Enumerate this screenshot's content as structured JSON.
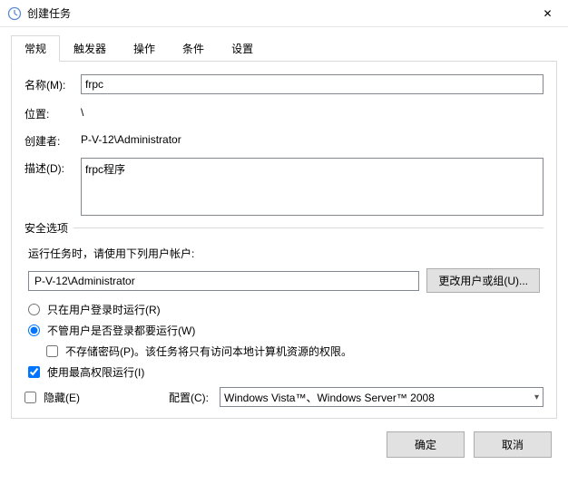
{
  "window": {
    "title": "创建任务",
    "close_glyph": "✕"
  },
  "tabs": {
    "general": "常规",
    "triggers": "触发器",
    "actions": "操作",
    "conditions": "条件",
    "settings": "设置"
  },
  "labels": {
    "name": "名称(M):",
    "location": "位置:",
    "author": "创建者:",
    "description": "描述(D):",
    "security": "安全选项",
    "run_as_prompt": "运行任务时，请使用下列用户帐户:",
    "change_user_btn": "更改用户或组(U)...",
    "radio_logged_on": "只在用户登录时运行(R)",
    "radio_whether": "不管用户是否登录都要运行(W)",
    "check_nopw": "不存储密码(P)。该任务将只有访问本地计算机资源的权限。",
    "check_highest": "使用最高权限运行(I)",
    "check_hidden": "隐藏(E)",
    "configure_for": "配置(C):",
    "ok": "确定",
    "cancel": "取消"
  },
  "values": {
    "name": "frpc",
    "location": "\\",
    "author": "P-V-12\\Administrator",
    "description": "frpc程序",
    "user_account": "P-V-12\\Administrator",
    "configure_for": "Windows Vista™、Windows Server™ 2008"
  },
  "state": {
    "radio_selected": "whether",
    "nopw_checked": false,
    "highest_checked": true,
    "hidden_checked": false
  }
}
